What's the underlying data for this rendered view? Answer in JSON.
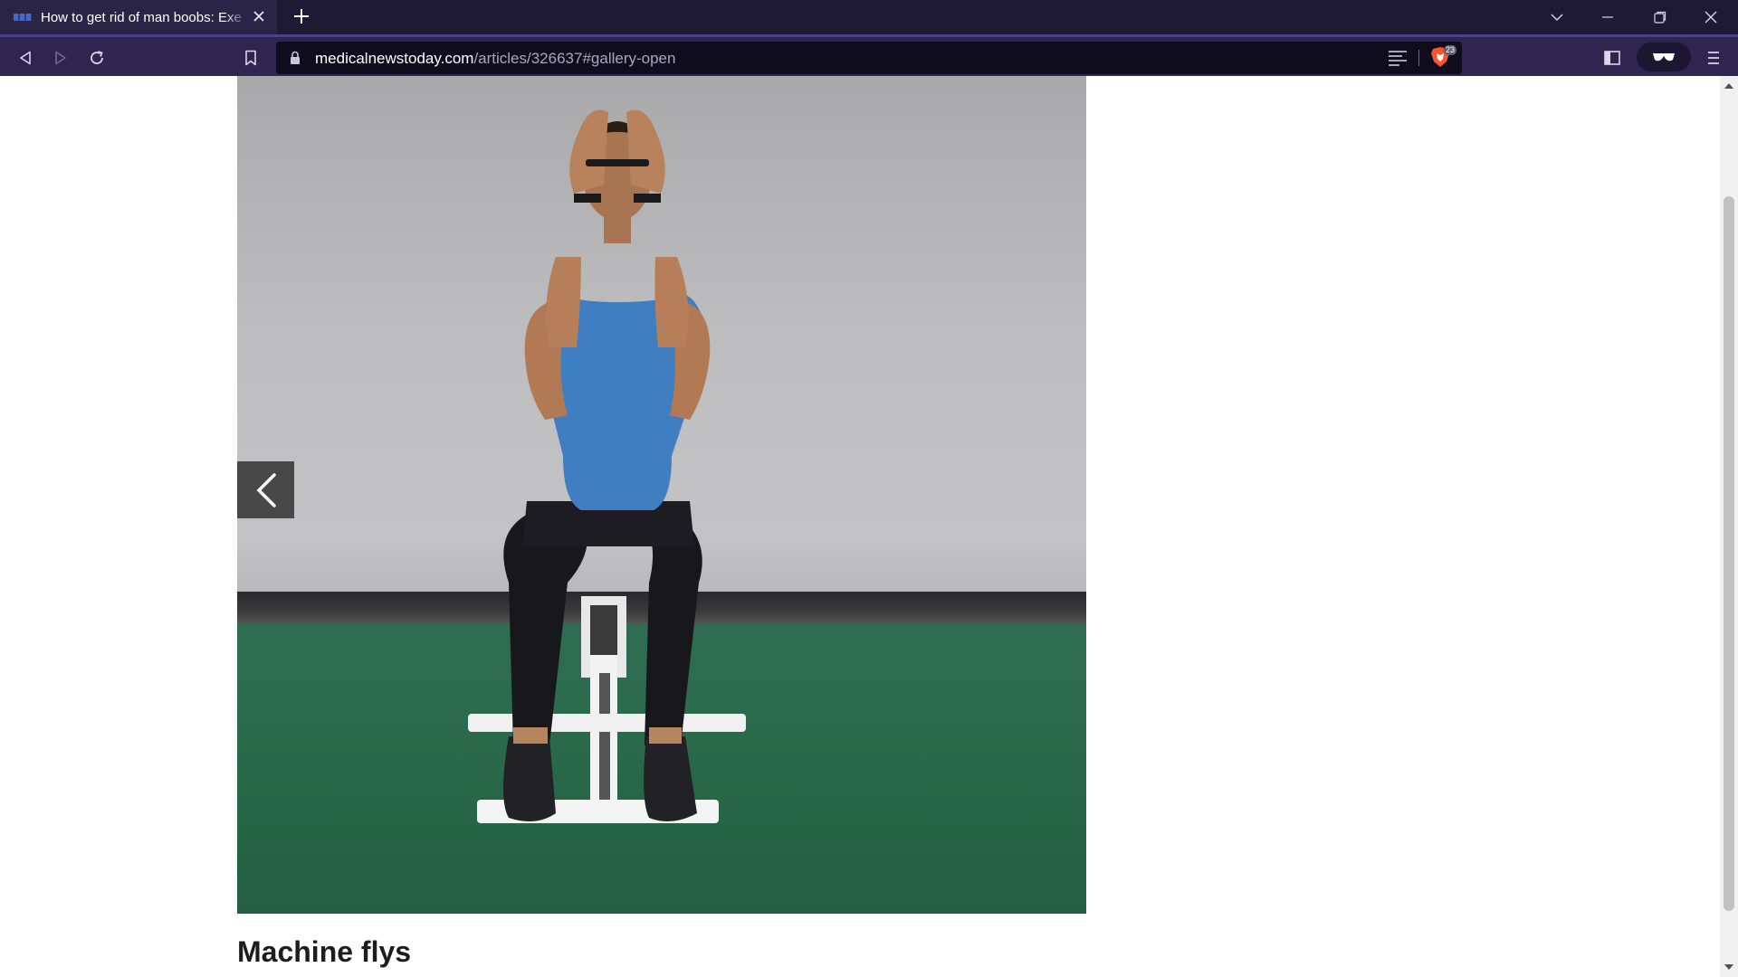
{
  "browser": {
    "tab": {
      "title": "How to get rid of man boobs: Exe",
      "favicon": "medicalnewstoday-favicon"
    },
    "toolbar": {
      "url_host": "medicalnewstoday.com",
      "url_path": "/articles/326637#gallery-open",
      "shields_count": "23"
    },
    "colors": {
      "tabstrip": "#1e1a33",
      "toolbar": "#2e2650",
      "urlbar": "#0f0c1d"
    }
  },
  "page": {
    "gallery": {
      "image_subject": "man seated on a bench performing machine flys",
      "prev_icon": "chevron-left-icon"
    },
    "caption": "Machine flys"
  }
}
